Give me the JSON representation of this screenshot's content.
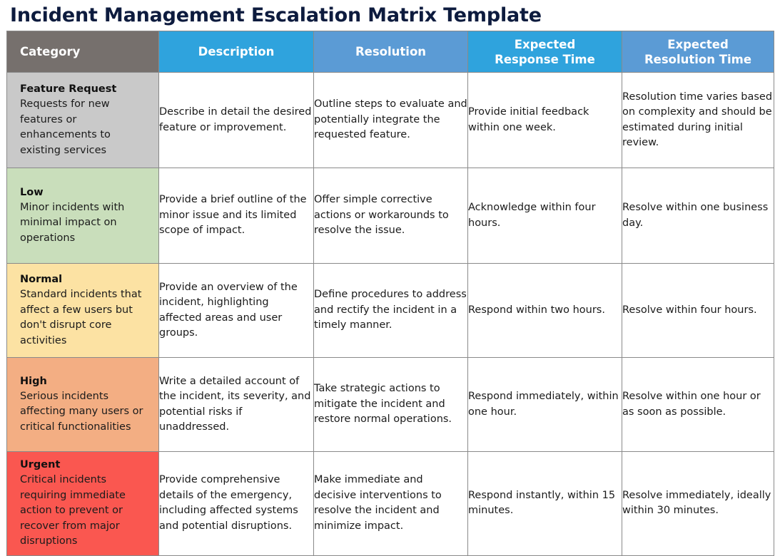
{
  "title": "Incident Management Escalation Matrix Template",
  "colors": {
    "title_text": "#0d1b3e",
    "header_category_bg": "#76706d",
    "header_blue_bright": "#2fa3dd",
    "header_blue_soft": "#5b9bd5",
    "row_feature_bg": "#c9c9c9",
    "row_low_bg": "#c9debb",
    "row_normal_bg": "#fce2a3",
    "row_high_bg": "#f3ae83",
    "row_urgent_bg": "#fa5750",
    "border": "#8a8a8a"
  },
  "table": {
    "headers": [
      "Category",
      "Description",
      "Resolution",
      "Expected\nResponse Time",
      "Expected\nResolution Time"
    ],
    "headers_lines": [
      [
        "Category"
      ],
      [
        "Description"
      ],
      [
        "Resolution"
      ],
      [
        "Expected",
        "Response Time"
      ],
      [
        "Expected",
        "Resolution Time"
      ]
    ],
    "rows": [
      {
        "key": "feature",
        "category_title": "Feature Request",
        "category_desc": "Requests for new features or enhancements to existing services",
        "description": "Describe in detail the desired feature or improvement.",
        "resolution": "Outline steps to evaluate and potentially integrate the requested feature.",
        "expected_response_time": "Provide initial feedback within one week.",
        "expected_resolution_time": "Resolution time varies based on complexity and should be estimated during initial review."
      },
      {
        "key": "low",
        "category_title": "Low",
        "category_desc": "Minor incidents with minimal impact on operations",
        "description": "Provide a brief outline of the minor issue and its limited scope of impact.",
        "resolution": "Offer simple corrective actions or workarounds to resolve the issue.",
        "expected_response_time": "Acknowledge within four hours.",
        "expected_resolution_time": "Resolve within one business day."
      },
      {
        "key": "normal",
        "category_title": "Normal",
        "category_desc": "Standard incidents that affect a few users but don't disrupt core activities",
        "description": "Provide an overview of the incident, highlighting affected areas and user groups.",
        "resolution": "Define procedures to address and rectify the incident in a timely manner.",
        "expected_response_time": "Respond within two hours.",
        "expected_resolution_time": "Resolve within four hours."
      },
      {
        "key": "high",
        "category_title": "High",
        "category_desc": "Serious incidents affecting many users or critical functionalities",
        "description": "Write a detailed account of the incident, its severity, and potential risks if unaddressed.",
        "resolution": "Take strategic actions to mitigate the incident and restore normal operations.",
        "expected_response_time": "Respond immediately, within one hour.",
        "expected_resolution_time": "Resolve within one hour or as soon as possible."
      },
      {
        "key": "urgent",
        "category_title": "Urgent",
        "category_desc": "Critical incidents requiring immediate action to prevent or recover from major disruptions",
        "description": "Provide comprehensive details of the emergency, including affected systems and potential disruptions.",
        "resolution": "Make immediate and decisive interventions to resolve the incident and minimize impact.",
        "expected_response_time": "Respond instantly, within 15 minutes.",
        "expected_resolution_time": "Resolve immediately, ideally within 30 minutes."
      }
    ]
  }
}
